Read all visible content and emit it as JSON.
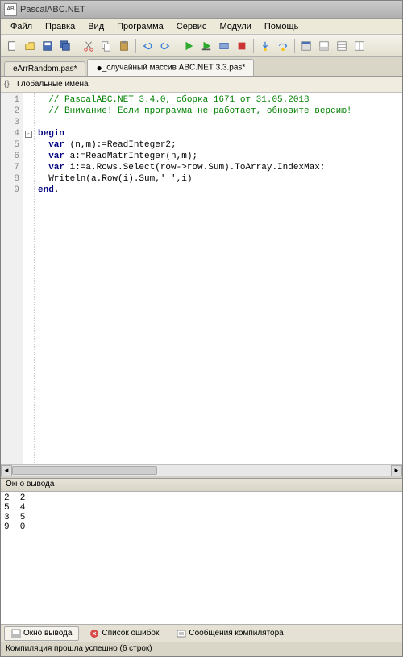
{
  "window": {
    "title": "PascalABC.NET",
    "icon_label": "AB"
  },
  "menu": {
    "file": "Файл",
    "edit": "Правка",
    "view": "Вид",
    "program": "Программа",
    "service": "Сервис",
    "modules": "Модули",
    "help": "Помощь"
  },
  "tabs": [
    {
      "label": "eArrRandom.pas*",
      "active": false,
      "dirty": true
    },
    {
      "label": "_случайный массив ABC.NET 3.3.pas*",
      "active": true,
      "dirty": true
    }
  ],
  "globals_label": "Глобальные имена",
  "code": {
    "lines": [
      {
        "n": 1,
        "type": "comment",
        "text": "// PascalABC.NET 3.4.0, сборка 1671 от 31.05.2018"
      },
      {
        "n": 2,
        "type": "comment",
        "text": "// Внимание! Если программа не работает, обновите версию!"
      },
      {
        "n": 3,
        "type": "blank",
        "text": ""
      },
      {
        "n": 4,
        "type": "kwline",
        "kw": "begin",
        "fold": true
      },
      {
        "n": 5,
        "type": "stmt",
        "kw": "var",
        "rest": " (n,m):=ReadInteger2;"
      },
      {
        "n": 6,
        "type": "stmt",
        "kw": "var",
        "rest": " a:=ReadMatrInteger(n,m);"
      },
      {
        "n": 7,
        "type": "stmt",
        "kw": "var",
        "rest": " i:=a.Rows.Select(row->row.Sum).ToArray.IndexMax;"
      },
      {
        "n": 8,
        "type": "plain",
        "text": "  Writeln(a.Row(i).Sum,' ',i)"
      },
      {
        "n": 9,
        "type": "kwline",
        "kw": "end",
        "tail": "."
      }
    ]
  },
  "output": {
    "title": "Окно вывода",
    "lines": [
      "2  2",
      "5  4",
      "3  5",
      "9  0"
    ]
  },
  "bottom_tabs": {
    "output": "Окно вывода",
    "errors": "Список ошибок",
    "compiler": "Сообщения компилятора"
  },
  "status": "Компиляция прошла успешно (6 строк)"
}
